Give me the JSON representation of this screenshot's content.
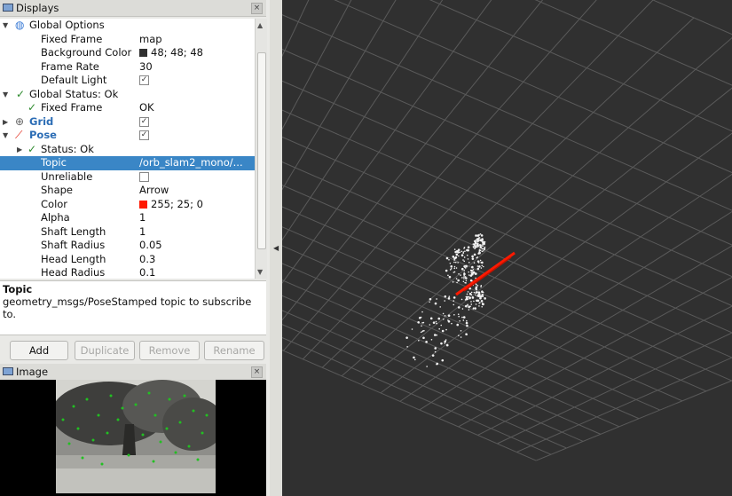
{
  "displays_panel": {
    "title": "Displays",
    "rows": [
      {
        "key": "Global Options"
      },
      {
        "key": "Fixed Frame",
        "value": "map"
      },
      {
        "key": "Background Color",
        "value": "48; 48; 48",
        "swatch": "#303030"
      },
      {
        "key": "Frame Rate",
        "value": "30"
      },
      {
        "key": "Default Light",
        "check": "✓"
      },
      {
        "key": "Global Status: Ok"
      },
      {
        "key": "Fixed Frame",
        "value": "OK"
      },
      {
        "key": "Grid",
        "check": "✓"
      },
      {
        "key": "Pose",
        "check": "✓"
      },
      {
        "key": "Status: Ok"
      },
      {
        "key": "Topic",
        "value": "/orb_slam2_mono/..."
      },
      {
        "key": "Unreliable",
        "check": ""
      },
      {
        "key": "Shape",
        "value": "Arrow"
      },
      {
        "key": "Color",
        "value": "255; 25; 0",
        "swatch": "#ff1900"
      },
      {
        "key": "Alpha",
        "value": "1"
      },
      {
        "key": "Shaft Length",
        "value": "1"
      },
      {
        "key": "Shaft Radius",
        "value": "0.05"
      },
      {
        "key": "Head Length",
        "value": "0.3"
      },
      {
        "key": "Head Radius",
        "value": "0.1"
      }
    ]
  },
  "description": {
    "heading": "Topic",
    "text": "geometry_msgs/PoseStamped topic to subscribe to."
  },
  "buttons": {
    "add": "Add",
    "duplicate": "Duplicate",
    "remove": "Remove",
    "rename": "Rename"
  },
  "image_panel": {
    "title": "Image"
  },
  "colors": {
    "viewport_bg": "#303030",
    "grid_line": "#5a5a5a",
    "pose_arrow": "#ff1900",
    "selection": "#3a86c6",
    "link": "#2c6db5"
  }
}
